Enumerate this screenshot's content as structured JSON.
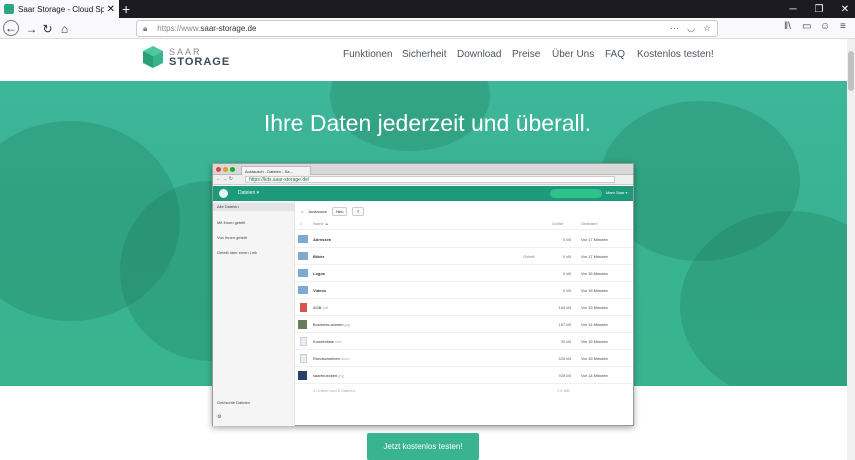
{
  "browser": {
    "tab_title": "Saar Storage - Cloud Speicher",
    "url_protocol": "https://www.",
    "url_host": "saar-storage.de",
    "more_icon": "···"
  },
  "site": {
    "logo_line1": "SAAR",
    "logo_line2": "STORAGE",
    "nav": [
      "Funktionen",
      "Sicherheit",
      "Download",
      "Preise",
      "Über Uns",
      "FAQ",
      "Kostenlos testen!"
    ],
    "hero_title": "Ihre Daten jederzeit und überall.",
    "cta": "Jetzt kostenlos testen!"
  },
  "app": {
    "tab_title": "Austausch - Dateien - Sa...",
    "url": "https://kits.saar-storage.de/",
    "app_menu": "Dateien ▾",
    "user": "Marc Saar ▾",
    "sidebar": [
      "Alle Dateien",
      "Mit Ihnen geteilt",
      "Von Ihnen geteilt",
      "Geteilt über einen Link"
    ],
    "deleted": "Gelöschte Dateien",
    "breadcrumb": "Austausch",
    "new_button": "Neu",
    "columns": {
      "name": "Name ▲",
      "size": "Größe",
      "modified": "Geändert"
    },
    "share_label": "Geteilt",
    "files": [
      {
        "name": "Adressen",
        "ext": "",
        "size": "0 kB",
        "date": "Vor 17 Minuten",
        "type": "folder"
      },
      {
        "name": "Bilder",
        "ext": "",
        "size": "0 kB",
        "date": "Vor 17 Minuten",
        "type": "folder-shared"
      },
      {
        "name": "Logos",
        "ext": "",
        "size": "0 kB",
        "date": "Vor 16 Minuten",
        "type": "folder"
      },
      {
        "name": "Videos",
        "ext": "",
        "size": "0 kB",
        "date": "Vor 16 Minuten",
        "type": "folder"
      },
      {
        "name": "AGB",
        "ext": ".pdf",
        "size": "160 kB",
        "date": "Vor 15 Minuten",
        "type": "pdf"
      },
      {
        "name": "Business-women",
        "ext": ".jpg",
        "size": "187 kB",
        "date": "Vor 14 Minuten",
        "type": "image"
      },
      {
        "name": "Kundenliste",
        "ext": ".xlsx",
        "size": "30 kB",
        "date": "Vor 15 Minuten",
        "type": "doc"
      },
      {
        "name": "Rundschreiben",
        "ext": ".docx",
        "size": "526 kB",
        "date": "Vor 15 Minuten",
        "type": "doc"
      },
      {
        "name": "saarbruecken",
        "ext": ".jpg",
        "size": "928 kB",
        "date": "Vor 14 Minuten",
        "type": "image2"
      }
    ],
    "summary": "4 Ordner und 5 Dateien",
    "summary_size": "1,6 MB"
  },
  "colors": {
    "accent": "#39b391",
    "header": "#1d9a7a",
    "folder": "#7fa9cf"
  }
}
